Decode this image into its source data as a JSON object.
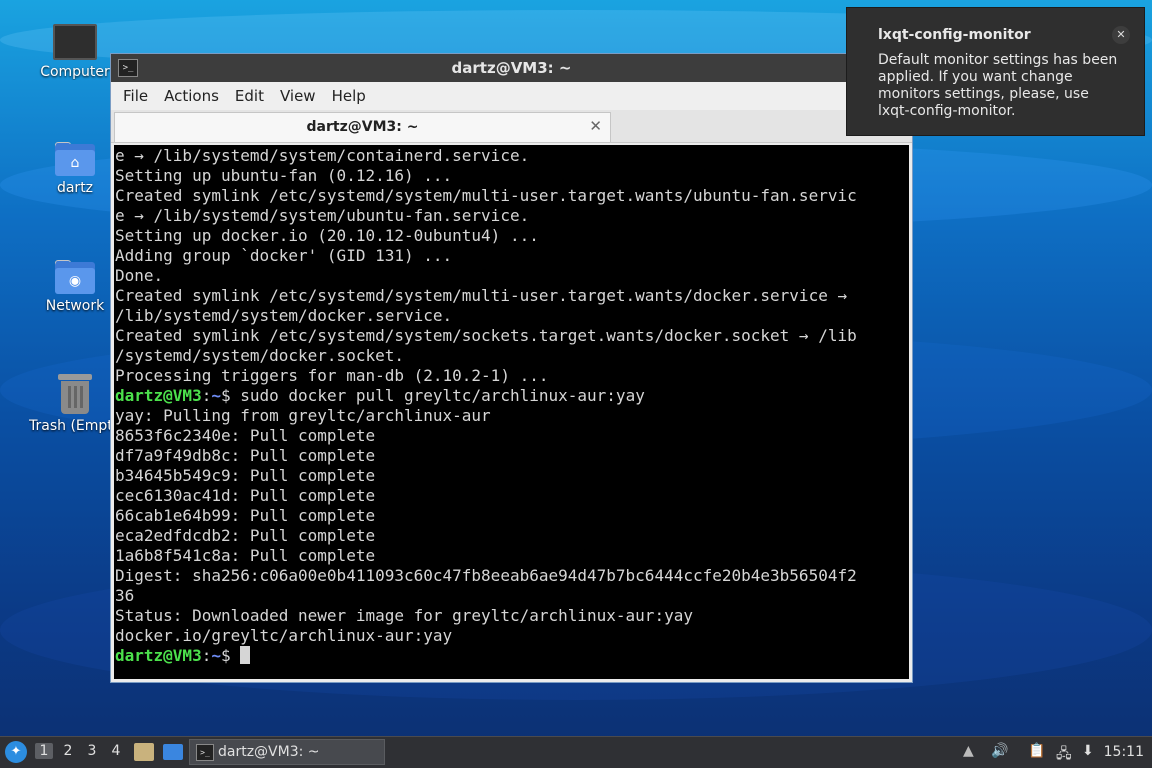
{
  "desktop": {
    "icons": [
      {
        "label": "Computer"
      },
      {
        "label": "dartz"
      },
      {
        "label": "Network"
      },
      {
        "label": "Trash (Empty)"
      }
    ]
  },
  "terminal_window": {
    "title": "dartz@VM3: ~",
    "menu": [
      "File",
      "Actions",
      "Edit",
      "View",
      "Help"
    ],
    "tab_label": "dartz@VM3: ~",
    "tab_close": "✕",
    "lines": [
      "e → /lib/systemd/system/containerd.service.",
      "Setting up ubuntu-fan (0.12.16) ...",
      "Created symlink /etc/systemd/system/multi-user.target.wants/ubuntu-fan.servic",
      "e → /lib/systemd/system/ubuntu-fan.service.",
      "Setting up docker.io (20.10.12-0ubuntu4) ...",
      "Adding group `docker' (GID 131) ...",
      "Done.",
      "Created symlink /etc/systemd/system/multi-user.target.wants/docker.service →",
      "/lib/systemd/system/docker.service.",
      "Created symlink /etc/systemd/system/sockets.target.wants/docker.socket → /lib",
      "/systemd/system/docker.socket.",
      "Processing triggers for man-db (2.10.2-1) ..."
    ],
    "prompt_user": "dartz@VM3",
    "prompt_sep": ":",
    "prompt_dir": "~",
    "prompt_end": "$ ",
    "command": "sudo docker pull greyltc/archlinux-aur:yay",
    "output": [
      "yay: Pulling from greyltc/archlinux-aur",
      "8653f6c2340e: Pull complete",
      "df7a9f49db8c: Pull complete",
      "b34645b549c9: Pull complete",
      "cec6130ac41d: Pull complete",
      "66cab1e64b99: Pull complete",
      "eca2edfdcdb2: Pull complete",
      "1a6b8f541c8a: Pull complete",
      "Digest: sha256:c06a00e0b411093c60c47fb8eeab6ae94d47b7bc6444ccfe20b4e3b56504f2",
      "36",
      "Status: Downloaded newer image for greyltc/archlinux-aur:yay",
      "docker.io/greyltc/archlinux-aur:yay"
    ]
  },
  "notification": {
    "title": "lxqt-config-monitor",
    "body": "Default monitor settings has been applied. If you want change monitors settings, please, use lxqt-config-monitor.",
    "close": "✕"
  },
  "taskbar": {
    "desktops": [
      "1",
      "2",
      "3",
      "4"
    ],
    "active_desktop": "1",
    "task_label": "dartz@VM3: ~",
    "clock": "15:11"
  }
}
